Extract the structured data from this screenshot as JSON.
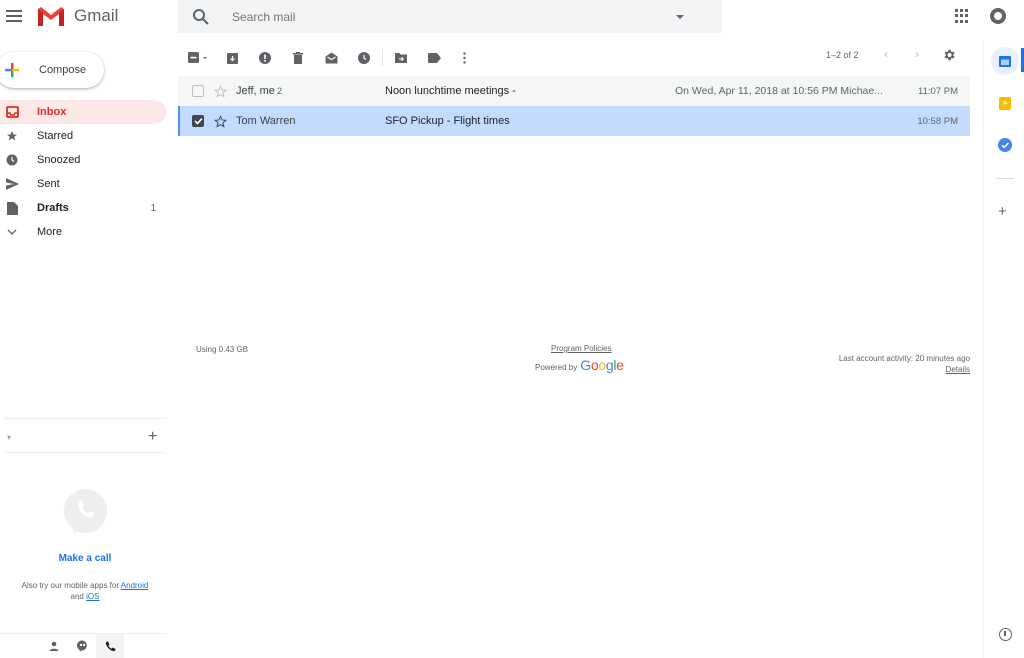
{
  "header": {
    "app_name": "Gmail",
    "search_placeholder": "Search mail"
  },
  "compose": {
    "label": "Compose"
  },
  "sidebar": {
    "items": [
      {
        "label": "Inbox",
        "icon": "inbox-icon",
        "count": "",
        "active": true
      },
      {
        "label": "Starred",
        "icon": "star-icon",
        "count": ""
      },
      {
        "label": "Snoozed",
        "icon": "clock-icon",
        "count": ""
      },
      {
        "label": "Sent",
        "icon": "send-icon",
        "count": ""
      },
      {
        "label": "Drafts",
        "icon": "draft-icon",
        "count": "1",
        "bold": true
      },
      {
        "label": "More",
        "icon": "chevron-down-icon",
        "count": ""
      }
    ]
  },
  "hangouts": {
    "make_call": "Make a call",
    "mobile_text": "Also try our mobile apps for",
    "android": "Android",
    "and": "and",
    "ios": "iOS"
  },
  "toolbar": {
    "pagination": "1–2 of 2"
  },
  "emails": [
    {
      "sender": "Jeff, me",
      "thread_count": "2",
      "subject": "Noon lunchtime meetings -",
      "snippet": "On Wed, Apr 11, 2018 at 10:56 PM Michae...",
      "time": "11:07 PM",
      "selected": false
    },
    {
      "sender": "Tom Warren",
      "thread_count": "",
      "subject": "SFO Pickup  - Flight times",
      "snippet": "",
      "time": "10:58 PM",
      "selected": true
    }
  ],
  "footer": {
    "storage": "Using 0.43 GB",
    "policies": "Program Policies",
    "powered_by": "Powered by",
    "google": [
      "G",
      "o",
      "o",
      "g",
      "l",
      "e"
    ],
    "last_activity": "Last account activity: 20 minutes ago",
    "details": "Details"
  },
  "colors": {
    "accent_red": "#d93025",
    "selected_row": "#c2dbff",
    "link_blue": "#1a73e8"
  }
}
